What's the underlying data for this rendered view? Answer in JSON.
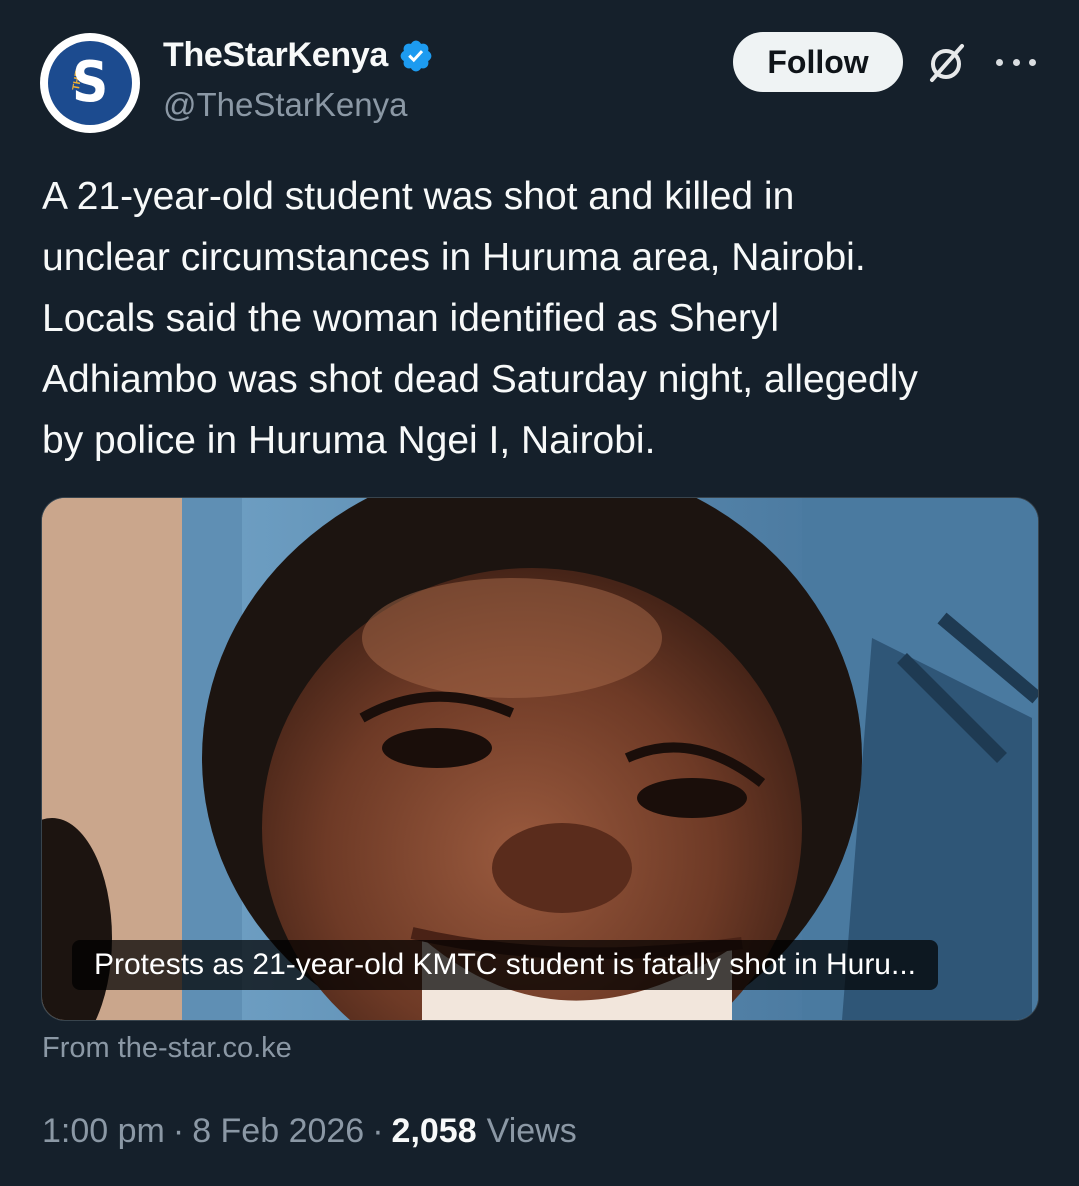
{
  "author": {
    "display_name": "TheStarKenya",
    "handle": "@TheStarKenya",
    "verified": true,
    "avatar_letter": "S",
    "avatar_small_text": "THE"
  },
  "header": {
    "follow_label": "Follow",
    "grok_icon": "grok-icon",
    "more_icon": "more-icon"
  },
  "tweet": {
    "text": "A 21-year-old student was shot and killed in\nunclear circumstances in Huruma area, Nairobi.\nLocals said the woman identified as Sheryl\nAdhiambo was shot dead Saturday night, allegedly\nby police in Huruma Ngei I, Nairobi."
  },
  "card": {
    "title": "Protests as 21-year-old KMTC student is fatally shot in Huru...",
    "source": "From the-star.co.ke"
  },
  "meta": {
    "time": "1:00 pm",
    "date": "8 Feb 2026",
    "views_count": "2,058",
    "views_label": "Views",
    "separator": "·"
  },
  "colors": {
    "background": "#15202b",
    "text": "#f7f9f9",
    "muted": "#8b98a5",
    "verified": "#1d9bf0",
    "follow_bg": "#eff3f4"
  }
}
